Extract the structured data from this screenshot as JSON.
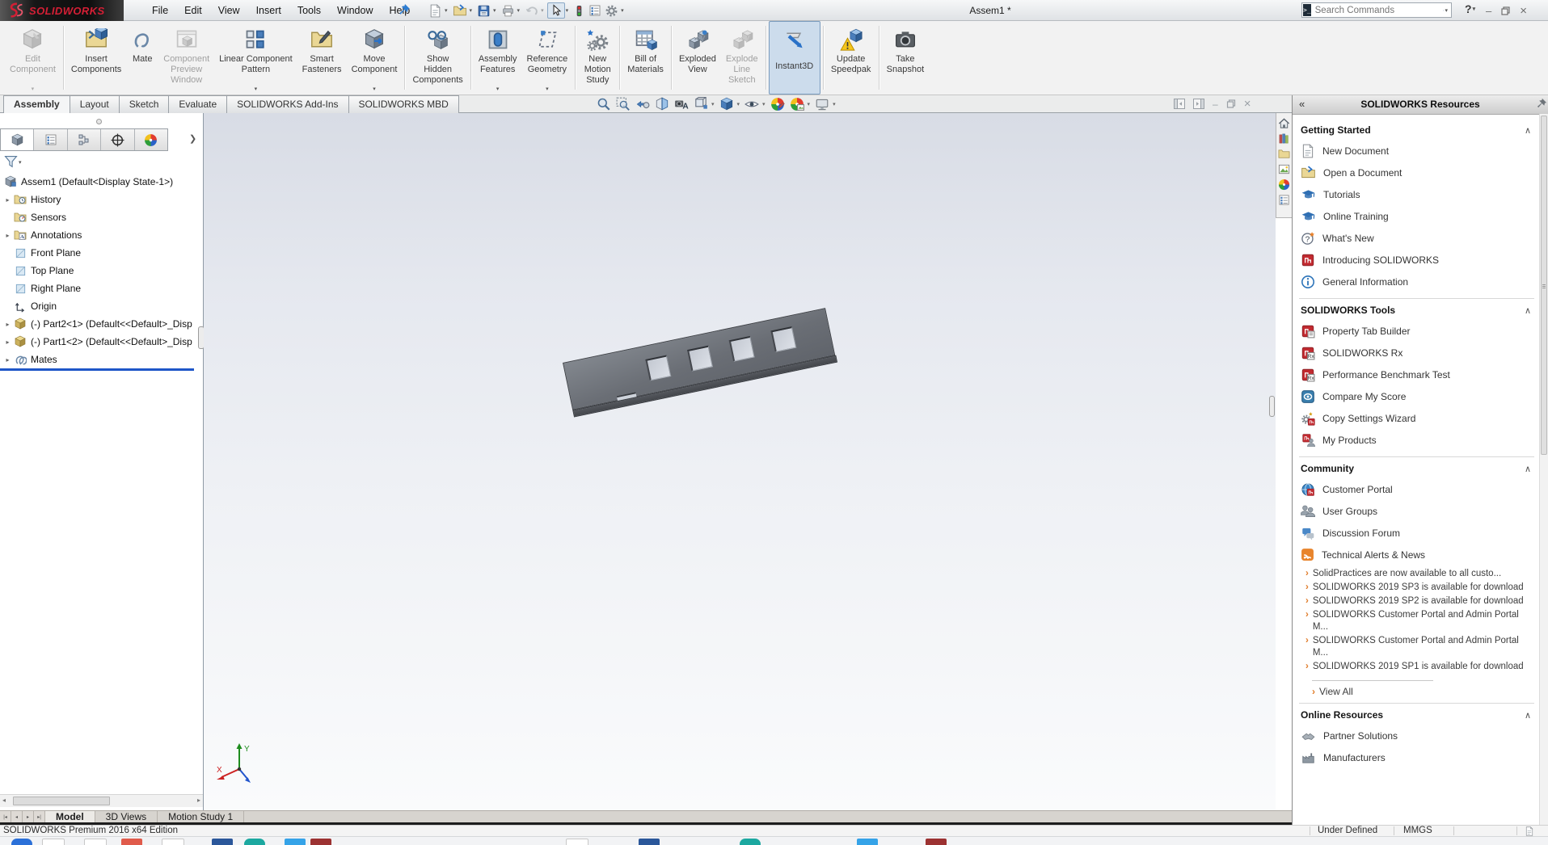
{
  "titlebar": {
    "logo_text": "SOLIDWORKS",
    "menus": [
      "File",
      "Edit",
      "View",
      "Insert",
      "Tools",
      "Window",
      "Help"
    ],
    "document_title": "Assem1 *",
    "search_placeholder": "Search Commands",
    "help_label": "?"
  },
  "quick_access_icons": [
    "new-document",
    "open-document",
    "save",
    "print",
    "undo",
    "select-arrow",
    "rebuild-traffic-light",
    "file-properties",
    "options-gear"
  ],
  "ribbon": {
    "buttons": [
      {
        "label": "Edit\nComponent",
        "state": "disabled",
        "dropdown": true
      },
      {
        "label": "Insert\nComponents",
        "state": "normal",
        "dropdown": false
      },
      {
        "label": "Mate",
        "state": "normal",
        "dropdown": false
      },
      {
        "label": "Component\nPreview\nWindow",
        "state": "disabled",
        "dropdown": false
      },
      {
        "label": "Linear Component\nPattern",
        "state": "normal",
        "dropdown": true
      },
      {
        "label": "Smart\nFasteners",
        "state": "normal",
        "dropdown": false
      },
      {
        "label": "Move\nComponent",
        "state": "normal",
        "dropdown": true
      },
      {
        "label": "Show\nHidden\nComponents",
        "state": "normal",
        "dropdown": false
      },
      {
        "label": "Assembly\nFeatures",
        "state": "normal",
        "dropdown": true
      },
      {
        "label": "Reference\nGeometry",
        "state": "normal",
        "dropdown": true
      },
      {
        "label": "New\nMotion\nStudy",
        "state": "normal",
        "dropdown": false
      },
      {
        "label": "Bill of\nMaterials",
        "state": "normal",
        "dropdown": false
      },
      {
        "label": "Exploded\nView",
        "state": "normal",
        "dropdown": false
      },
      {
        "label": "Explode\nLine\nSketch",
        "state": "disabled",
        "dropdown": false
      },
      {
        "label": "Instant3D",
        "state": "active",
        "dropdown": false
      },
      {
        "label": "Update\nSpeedpak",
        "state": "normal",
        "dropdown": false
      },
      {
        "label": "Take\nSnapshot",
        "state": "normal",
        "dropdown": false
      }
    ]
  },
  "command_tabs": {
    "tabs": [
      "Assembly",
      "Layout",
      "Sketch",
      "Evaluate",
      "SOLIDWORKS Add-Ins",
      "SOLIDWORKS MBD"
    ],
    "active": "Assembly"
  },
  "headsup_tools": [
    "zoom-to-fit",
    "zoom-to-area",
    "previous-view",
    "section-view",
    "dynamic-annotation-views",
    "view-orientation",
    "display-style",
    "hide-show-items",
    "edit-appearance",
    "apply-scene",
    "view-settings"
  ],
  "feature_panel": {
    "tabs": [
      "featuremanager-design-tree",
      "propertymanager",
      "configurationmanager",
      "dimxpertmanager",
      "displaymanager"
    ],
    "root_label": "Assem1 (Default<Display State-1>)",
    "items": [
      {
        "label": "History",
        "expandable": true
      },
      {
        "label": "Sensors",
        "expandable": false
      },
      {
        "label": "Annotations",
        "expandable": true
      },
      {
        "label": "Front Plane",
        "expandable": false
      },
      {
        "label": "Top Plane",
        "expandable": false
      },
      {
        "label": "Right Plane",
        "expandable": false
      },
      {
        "label": "Origin",
        "expandable": false
      },
      {
        "label": "(-) Part2<1> (Default<<Default>_Disp",
        "expandable": true
      },
      {
        "label": "(-) Part1<2> (Default<<Default>_Disp",
        "expandable": true
      },
      {
        "label": "Mates",
        "expandable": true
      }
    ]
  },
  "taskpane": {
    "title": "SOLIDWORKS Resources",
    "sections": {
      "getting_started": {
        "title": "Getting Started",
        "items": [
          "New Document",
          "Open a Document",
          "Tutorials",
          "Online Training",
          "What's New",
          "Introducing SOLIDWORKS",
          "General Information"
        ]
      },
      "tools": {
        "title": "SOLIDWORKS Tools",
        "items": [
          "Property Tab Builder",
          "SOLIDWORKS Rx",
          "Performance Benchmark Test",
          "Compare My Score",
          "Copy Settings Wizard",
          "My Products"
        ]
      },
      "community": {
        "title": "Community",
        "items": [
          "Customer Portal",
          "User Groups",
          "Discussion Forum",
          "Technical Alerts & News"
        ],
        "news": [
          "SolidPractices are now available to all custo...",
          "SOLIDWORKS 2019 SP3 is available for download",
          "SOLIDWORKS 2019 SP2 is available for download",
          "SOLIDWORKS Customer Portal and Admin Portal M...",
          "SOLIDWORKS Customer Portal and Admin Portal M...",
          "SOLIDWORKS 2019 SP1 is available for download"
        ],
        "view_all": "View All"
      },
      "online_resources": {
        "title": "Online Resources",
        "items": [
          "Partner Solutions",
          "Manufacturers"
        ]
      }
    }
  },
  "viewport": {
    "triad": {
      "x_label": "X",
      "y_label": "Y"
    }
  },
  "bottom": {
    "doc_tabs": [
      "Model",
      "3D Views",
      "Motion Study 1"
    ],
    "active_tab": "Model",
    "status_left": "SOLIDWORKS Premium 2016 x64 Edition",
    "status_state": "Under Defined",
    "units": "MMGS"
  },
  "colors": {
    "logo_red": "#d41f35",
    "rollback_blue": "#1e56c8",
    "news_bullet": "#e07b28",
    "instant3d_active_bg": "#ccdcec"
  }
}
